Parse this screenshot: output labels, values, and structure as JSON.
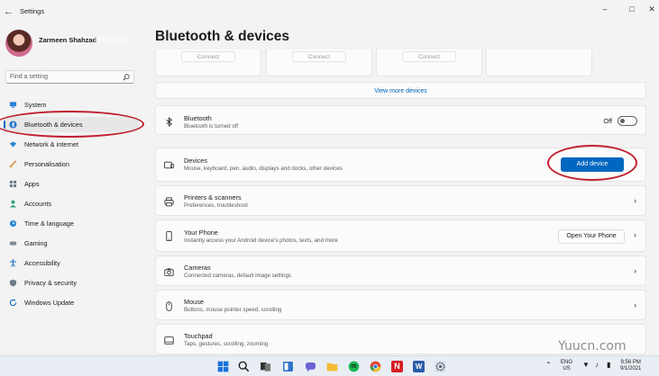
{
  "window": {
    "title": "Settings"
  },
  "profile": {
    "name": "Zarmeen Shahzad"
  },
  "search": {
    "placeholder": "Find a setting"
  },
  "sidebar": {
    "items": [
      {
        "label": "System",
        "icon": "monitor-icon"
      },
      {
        "label": "Bluetooth & devices",
        "icon": "bluetooth-icon",
        "active": true
      },
      {
        "label": "Network & internet",
        "icon": "wifi-icon"
      },
      {
        "label": "Personalisation",
        "icon": "brush-icon"
      },
      {
        "label": "Apps",
        "icon": "apps-icon"
      },
      {
        "label": "Accounts",
        "icon": "person-icon"
      },
      {
        "label": "Time & language",
        "icon": "globe-clock-icon"
      },
      {
        "label": "Gaming",
        "icon": "gamepad-icon"
      },
      {
        "label": "Accessibility",
        "icon": "accessibility-icon"
      },
      {
        "label": "Privacy & security",
        "icon": "shield-icon"
      },
      {
        "label": "Windows Update",
        "icon": "update-icon"
      }
    ]
  },
  "main": {
    "title": "Bluetooth & devices",
    "device_tiles": [
      {
        "button": "Connect"
      },
      {
        "button": "Connect"
      },
      {
        "button": "Connect"
      },
      {
        "button": ""
      }
    ],
    "view_more": "View more devices",
    "bluetooth": {
      "title": "Bluetooth",
      "subtitle": "Bluetooth is turned off",
      "state": "Off"
    },
    "devices": {
      "title": "Devices",
      "subtitle": "Mouse, keyboard, pen, audio, displays and docks, other devices",
      "button": "Add device"
    },
    "printers": {
      "title": "Printers & scanners",
      "subtitle": "Preferences, troubleshoot"
    },
    "phone": {
      "title": "Your Phone",
      "subtitle": "Instantly access your Android device's photos, texts, and more",
      "button": "Open Your Phone"
    },
    "cameras": {
      "title": "Cameras",
      "subtitle": "Connected cameras, default image settings"
    },
    "mouse": {
      "title": "Mouse",
      "subtitle": "Buttons, mouse pointer speed, scrolling"
    },
    "touchpad": {
      "title": "Touchpad",
      "subtitle": "Taps, gestures, scrolling, zooming"
    }
  },
  "taskbar": {
    "lang_top": "ENG",
    "lang_bottom": "US",
    "time": "9:56 PM",
    "date": "9/1/2021"
  },
  "watermark": "Yuucn.com",
  "colors": {
    "accent": "#0067c0",
    "annotation": "#c0202e"
  }
}
